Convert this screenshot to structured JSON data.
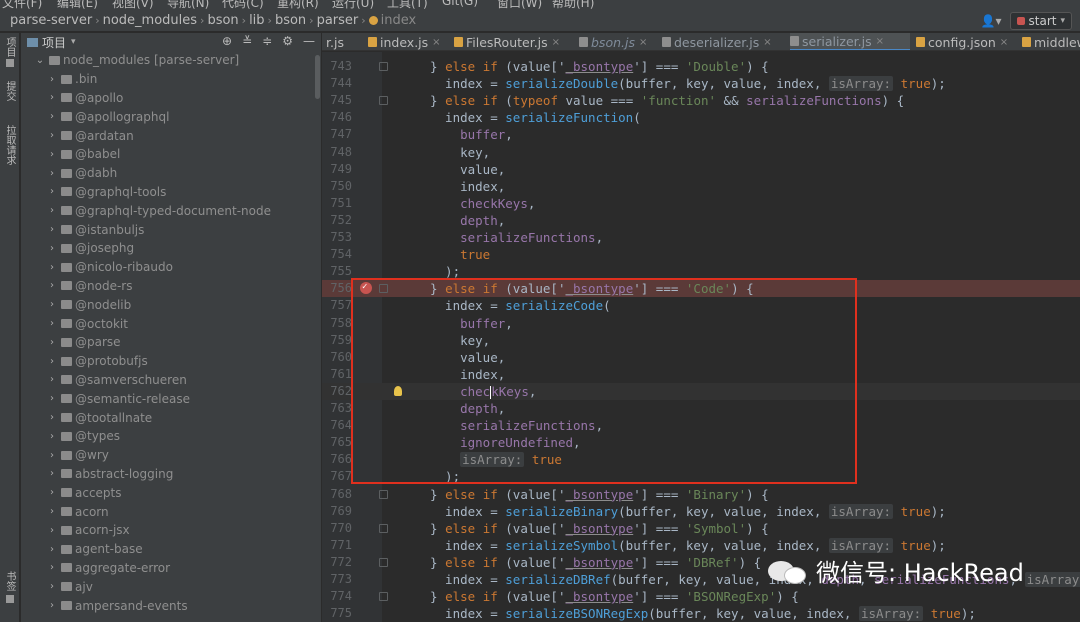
{
  "menubar": {
    "items": [
      "文件(F)",
      "编辑(E)",
      "视图(V)",
      "导航(N)",
      "代码(C)",
      "重构(R)",
      "运行(U)",
      "工具(T)",
      "Git(G)",
      "窗口(W)",
      "帮助(H)"
    ]
  },
  "breadcrumbs": [
    "parse-server",
    "node_modules",
    "bson",
    "lib",
    "bson",
    "parser",
    "index"
  ],
  "run_config": "start",
  "left_strip": {
    "project": "项目",
    "commit": "提交",
    "pull_requests": "拉取请求",
    "bookmarks": "书签"
  },
  "project_panel": {
    "title": "项目",
    "root": "node_modules [parse-server]",
    "items": [
      ".bin",
      "@apollo",
      "@apollographql",
      "@ardatan",
      "@babel",
      "@dabh",
      "@graphql-tools",
      "@graphql-typed-document-node",
      "@istanbuljs",
      "@josephg",
      "@nicolo-ribaudo",
      "@node-rs",
      "@nodelib",
      "@octokit",
      "@parse",
      "@protobufjs",
      "@samverschueren",
      "@semantic-release",
      "@tootallnate",
      "@types",
      "@wry",
      "abstract-logging",
      "accepts",
      "acorn",
      "acorn-jsx",
      "agent-base",
      "aggregate-error",
      "ajv",
      "ampersand-events"
    ]
  },
  "tabs": [
    {
      "label": "r.js"
    },
    {
      "label": "index.js"
    },
    {
      "label": "FilesRouter.js"
    },
    {
      "label": "bson.js"
    },
    {
      "label": "deserializer.js"
    },
    {
      "label": "serializer.js"
    },
    {
      "label": "config.json"
    },
    {
      "label": "middlew"
    }
  ],
  "code": {
    "line_numbers": [
      "743",
      "744",
      "745",
      "746",
      "747",
      "748",
      "749",
      "750",
      "751",
      "752",
      "753",
      "754",
      "755",
      "756",
      "757",
      "758",
      "759",
      "760",
      "761",
      "762",
      "763",
      "764",
      "765",
      "766",
      "767",
      "768",
      "769",
      "770",
      "771",
      "772",
      "773",
      "774",
      "775"
    ],
    "breakpoint_line": "756",
    "caret_line": "762"
  },
  "watermark": "微信号: HackRead",
  "colors": {
    "breakpoint": "#c75450",
    "highlight_box": "#e0301e",
    "keyword": "#cc7832",
    "string": "#6a8759",
    "function": "#4e9fd8"
  }
}
